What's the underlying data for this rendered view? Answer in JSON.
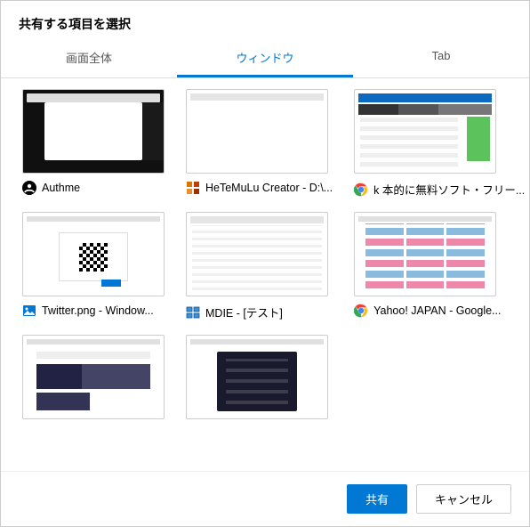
{
  "dialog": {
    "title": "共有する項目を選択"
  },
  "tabs": [
    {
      "label": "画面全体",
      "active": false
    },
    {
      "label": "ウィンドウ",
      "active": true
    },
    {
      "label": "Tab",
      "active": false
    }
  ],
  "windows": [
    {
      "label": "Authme",
      "icon": "authme"
    },
    {
      "label": "HeTeMuLu Creator - D:\\...",
      "icon": "hetemulu"
    },
    {
      "label": "k 本的に無料ソフト・フリー...",
      "icon": "chrome"
    },
    {
      "label": "Twitter.png - Window...",
      "icon": "photos"
    },
    {
      "label": "MDIE - [テスト]",
      "icon": "mdie"
    },
    {
      "label": "Yahoo! JAPAN - Google...",
      "icon": "chrome"
    },
    {
      "label": "",
      "icon": ""
    },
    {
      "label": "",
      "icon": ""
    }
  ],
  "footer": {
    "share": "共有",
    "cancel": "キャンセル"
  }
}
